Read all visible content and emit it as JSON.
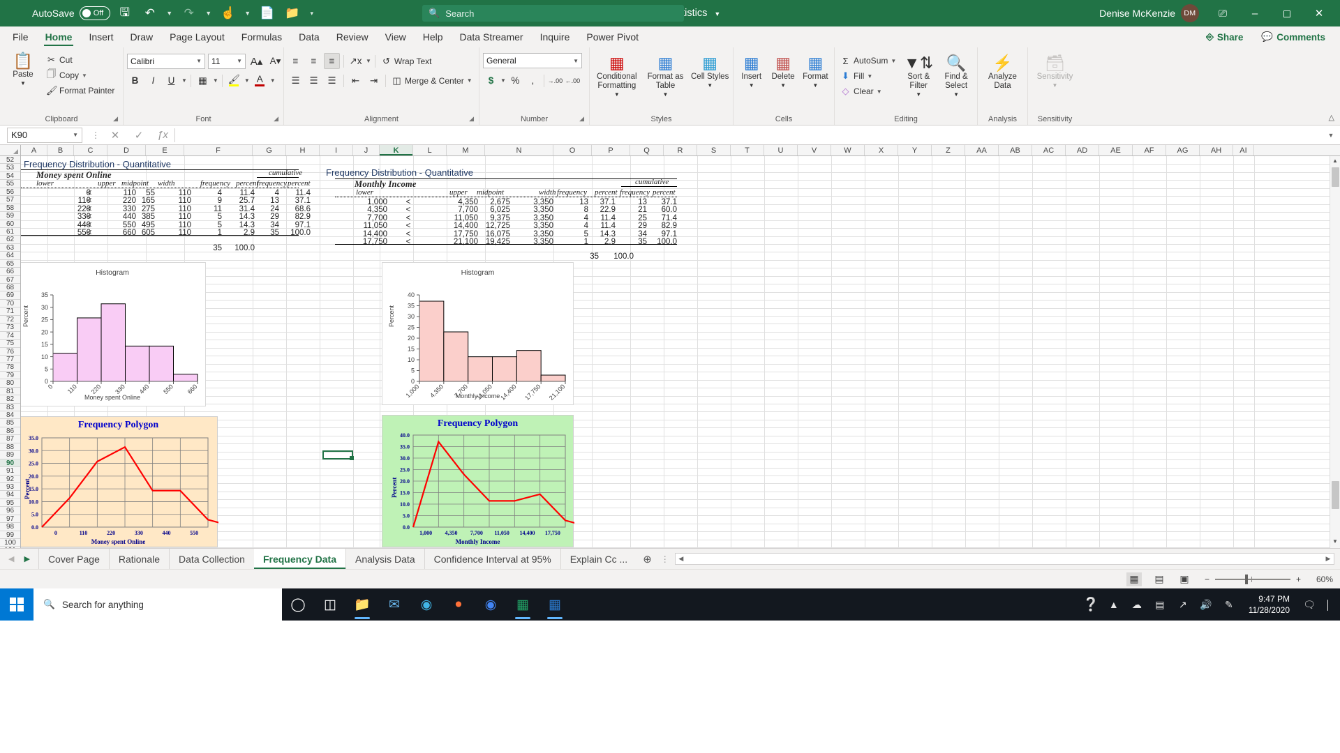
{
  "titlebar": {
    "autosave_label": "AutoSave",
    "autosave_state": "Off",
    "doc_title": "Inferential Statistics",
    "search_placeholder": "Search",
    "user_name": "Denise McKenzie",
    "user_initials": "DM",
    "icons": [
      "save-icon",
      "undo-icon",
      "redo-icon",
      "touch-mode-icon",
      "new-icon",
      "open-icon",
      "customize-icon"
    ]
  },
  "ribbon_tabs": {
    "items": [
      {
        "label": "File"
      },
      {
        "label": "Home"
      },
      {
        "label": "Insert"
      },
      {
        "label": "Draw"
      },
      {
        "label": "Page Layout"
      },
      {
        "label": "Formulas"
      },
      {
        "label": "Data"
      },
      {
        "label": "Review"
      },
      {
        "label": "View"
      },
      {
        "label": "Help"
      },
      {
        "label": "Data Streamer"
      },
      {
        "label": "Inquire"
      },
      {
        "label": "Power Pivot"
      }
    ],
    "active": "Home",
    "share_label": "Share",
    "comments_label": "Comments"
  },
  "ribbon": {
    "clipboard": {
      "group_label": "Clipboard",
      "paste_label": "Paste",
      "cut_label": "Cut",
      "copy_label": "Copy",
      "format_painter_label": "Format Painter"
    },
    "font": {
      "group_label": "Font",
      "font_name": "Calibri",
      "font_size": "11",
      "grow_label": "A",
      "shrink_label": "A",
      "bold_label": "B",
      "italic_label": "I",
      "underline_label": "U"
    },
    "alignment": {
      "group_label": "Alignment",
      "wrap_text_label": "Wrap Text",
      "merge_center_label": "Merge & Center"
    },
    "number": {
      "group_label": "Number",
      "format": "General",
      "currency_label": "$",
      "percent_label": "%",
      "comma_label": ",",
      "inc_dec_label": ".00",
      "dec_dec_label": ".00"
    },
    "styles": {
      "group_label": "Styles",
      "conditional_label": "Conditional Formatting",
      "table_label": "Format as Table",
      "cell_styles_label": "Cell Styles"
    },
    "cells": {
      "group_label": "Cells",
      "insert_label": "Insert",
      "delete_label": "Delete",
      "format_label": "Format"
    },
    "editing": {
      "group_label": "Editing",
      "autosum_label": "AutoSum",
      "fill_label": "Fill",
      "clear_label": "Clear",
      "sort_filter_label": "Sort & Filter",
      "find_select_label": "Find & Select"
    },
    "analysis": {
      "group_label": "Analysis",
      "analyze_data_label": "Analyze Data"
    },
    "sensitivity": {
      "group_label": "Sensitivity",
      "sensitivity_label": "Sensitivity"
    }
  },
  "formula_bar": {
    "name_box": "K90",
    "formula": "",
    "cancel_icon": "cancel-icon",
    "enter_icon": "check-icon",
    "function_icon": "fx-icon"
  },
  "grid": {
    "columns": [
      "A",
      "B",
      "C",
      "D",
      "E",
      "F",
      "G",
      "H",
      "I",
      "J",
      "K",
      "L",
      "M",
      "N",
      "O",
      "P",
      "Q",
      "R",
      "S",
      "T",
      "U",
      "V",
      "W",
      "X",
      "Y",
      "Z",
      "AA",
      "AB",
      "AC",
      "AD",
      "AE",
      "AF",
      "AG",
      "AH",
      "AI"
    ],
    "selected_column": "K",
    "rows_start": 52,
    "rows_end": 101,
    "selected_row": 90,
    "selected_cell": "K90"
  },
  "left_table": {
    "title": "Frequency Distribution - Quantitative",
    "group_title": "Money spent Online",
    "headers": {
      "lower": "lower",
      "upper": "upper",
      "midpoint": "midpoint",
      "width": "width",
      "frequency": "frequency",
      "percent": "percent",
      "cumulative": "cumulative",
      "cum_frequency": "frequency",
      "cum_percent": "percent"
    },
    "rows": [
      {
        "lower": "0",
        "op": "<",
        "upper": "110",
        "midpoint": "55",
        "width": "110",
        "frequency": "4",
        "percent": "11.4",
        "cum_frequency": "4",
        "cum_percent": "11.4"
      },
      {
        "lower": "110",
        "op": "<",
        "upper": "220",
        "midpoint": "165",
        "width": "110",
        "frequency": "9",
        "percent": "25.7",
        "cum_frequency": "13",
        "cum_percent": "37.1"
      },
      {
        "lower": "220",
        "op": "<",
        "upper": "330",
        "midpoint": "275",
        "width": "110",
        "frequency": "11",
        "percent": "31.4",
        "cum_frequency": "24",
        "cum_percent": "68.6"
      },
      {
        "lower": "330",
        "op": "<",
        "upper": "440",
        "midpoint": "385",
        "width": "110",
        "frequency": "5",
        "percent": "14.3",
        "cum_frequency": "29",
        "cum_percent": "82.9"
      },
      {
        "lower": "440",
        "op": "<",
        "upper": "550",
        "midpoint": "495",
        "width": "110",
        "frequency": "5",
        "percent": "14.3",
        "cum_frequency": "34",
        "cum_percent": "97.1"
      },
      {
        "lower": "550",
        "op": "<",
        "upper": "660",
        "midpoint": "605",
        "width": "110",
        "frequency": "1",
        "percent": "2.9",
        "cum_frequency": "35",
        "cum_percent": "100.0"
      }
    ],
    "total_frequency": "35",
    "total_percent": "100.0"
  },
  "right_table": {
    "title": "Frequency Distribution - Quantitative",
    "group_title": "Monthly Income",
    "headers": {
      "lower": "lower",
      "upper": "upper",
      "midpoint": "midpoint",
      "width": "width",
      "frequency": "frequency",
      "percent": "percent",
      "cumulative": "cumulative",
      "cum_frequency": "frequency",
      "cum_percent": "percent"
    },
    "rows": [
      {
        "lower": "1,000",
        "op": "<",
        "upper": "4,350",
        "midpoint": "2,675",
        "width": "3,350",
        "frequency": "13",
        "percent": "37.1",
        "cum_frequency": "13",
        "cum_percent": "37.1"
      },
      {
        "lower": "4,350",
        "op": "<",
        "upper": "7,700",
        "midpoint": "6,025",
        "width": "3,350",
        "frequency": "8",
        "percent": "22.9",
        "cum_frequency": "21",
        "cum_percent": "60.0"
      },
      {
        "lower": "7,700",
        "op": "<",
        "upper": "11,050",
        "midpoint": "9,375",
        "width": "3,350",
        "frequency": "4",
        "percent": "11.4",
        "cum_frequency": "25",
        "cum_percent": "71.4"
      },
      {
        "lower": "11,050",
        "op": "<",
        "upper": "14,400",
        "midpoint": "12,725",
        "width": "3,350",
        "frequency": "4",
        "percent": "11.4",
        "cum_frequency": "29",
        "cum_percent": "82.9"
      },
      {
        "lower": "14,400",
        "op": "<",
        "upper": "17,750",
        "midpoint": "16,075",
        "width": "3,350",
        "frequency": "5",
        "percent": "14.3",
        "cum_frequency": "34",
        "cum_percent": "97.1"
      },
      {
        "lower": "17,750",
        "op": "<",
        "upper": "21,100",
        "midpoint": "19,425",
        "width": "3,350",
        "frequency": "1",
        "percent": "2.9",
        "cum_frequency": "35",
        "cum_percent": "100.0"
      }
    ],
    "total_frequency": "35",
    "total_percent": "100.0"
  },
  "chart_data": [
    {
      "type": "bar",
      "name": "left-histogram",
      "title": "Histogram",
      "xlabel": "Money spent Online",
      "ylabel": "Percent",
      "categories": [
        "0",
        "110",
        "220",
        "330",
        "440",
        "550",
        "660"
      ],
      "bin_edges": [
        0,
        110,
        220,
        330,
        440,
        550,
        660
      ],
      "values": [
        11.4,
        25.7,
        31.4,
        14.3,
        14.3,
        2.9
      ],
      "yticks": [
        0,
        5,
        10,
        15,
        20,
        25,
        30,
        35
      ],
      "ylim": [
        0,
        35
      ],
      "bar_fill": "#f9ccf5",
      "bar_stroke": "#000000",
      "grid": false,
      "legend": "none"
    },
    {
      "type": "bar",
      "name": "right-histogram",
      "title": "Histogram",
      "xlabel": "Monthly Income",
      "ylabel": "Percent",
      "categories": [
        "1,000",
        "4,350",
        "7,700",
        "11,050",
        "14,400",
        "17,750",
        "21,100"
      ],
      "bin_edges": [
        1000,
        4350,
        7700,
        11050,
        14400,
        17750,
        21100
      ],
      "values": [
        37.1,
        22.9,
        11.4,
        11.4,
        14.3,
        2.9
      ],
      "yticks": [
        0,
        5,
        10,
        15,
        20,
        25,
        30,
        35,
        40
      ],
      "ylim": [
        0,
        40
      ],
      "bar_fill": "#fbcfcb",
      "bar_stroke": "#000000",
      "grid": false,
      "legend": "none"
    },
    {
      "type": "line",
      "name": "left-frequency-polygon",
      "title": "Frequency Polygon",
      "xlabel": "Money spent Online",
      "ylabel": "Percent",
      "x": [
        "0",
        "110",
        "220",
        "330",
        "440",
        "550"
      ],
      "categories": [
        "0",
        "110",
        "220",
        "330",
        "440",
        "550"
      ],
      "values": [
        0.0,
        11.4,
        25.7,
        31.4,
        14.3,
        14.3,
        2.9,
        0.0
      ],
      "series": [
        {
          "name": "Percent",
          "values": [
            0.0,
            11.4,
            25.7,
            31.4,
            14.3,
            14.3,
            2.9,
            0.0
          ]
        }
      ],
      "yticks": [
        "0.0",
        "5.0",
        "10.0",
        "15.0",
        "20.0",
        "25.0",
        "30.0",
        "35.0"
      ],
      "ylim": [
        0,
        35
      ],
      "line_color": "#ff0000",
      "plot_bg": "#ffe8c6",
      "title_color": "#0000cc",
      "grid": true,
      "legend": "none"
    },
    {
      "type": "line",
      "name": "right-frequency-polygon",
      "title": "Frequency Polygon",
      "xlabel": "Monthly Income",
      "ylabel": "Percent",
      "x": [
        "1,000",
        "4,350",
        "7,700",
        "11,050",
        "14,400",
        "17,750"
      ],
      "categories": [
        "1,000",
        "4,350",
        "7,700",
        "11,050",
        "14,400",
        "17,750"
      ],
      "values": [
        0.0,
        37.1,
        22.9,
        11.4,
        11.4,
        14.3,
        2.9,
        0.0
      ],
      "series": [
        {
          "name": "Percent",
          "values": [
            0.0,
            37.1,
            22.9,
            11.4,
            11.4,
            14.3,
            2.9,
            0.0
          ]
        }
      ],
      "yticks": [
        "0.0",
        "5.0",
        "10.0",
        "15.0",
        "20.0",
        "25.0",
        "30.0",
        "35.0",
        "40.0"
      ],
      "ylim": [
        0,
        40
      ],
      "line_color": "#ff0000",
      "plot_bg": "#bff2b6",
      "title_color": "#0000cc",
      "grid": true,
      "legend": "none"
    }
  ],
  "sheet_tabs": {
    "items": [
      {
        "label": "Cover Page"
      },
      {
        "label": "Rationale"
      },
      {
        "label": "Data Collection"
      },
      {
        "label": "Frequency Data"
      },
      {
        "label": "Analysis Data"
      },
      {
        "label": "Confidence Interval at 95%"
      },
      {
        "label": "Explain Cc ..."
      }
    ],
    "active": "Frequency Data",
    "add_sheet_label": "+"
  },
  "status_bar": {
    "views": [
      "normal-view-icon",
      "page-layout-icon",
      "page-break-icon"
    ],
    "zoom_value": "60%",
    "zoom_out": "−",
    "zoom_in": "+"
  },
  "taskbar": {
    "search_placeholder": "Search for anything",
    "time": "9:47 PM",
    "date": "11/28/2020",
    "apps": [
      "cortana-icon",
      "task-view-icon",
      "file-explorer-icon",
      "mail-icon",
      "edge-icon",
      "firefox-icon",
      "chrome-icon",
      "excel-icon",
      "word-icon"
    ]
  }
}
